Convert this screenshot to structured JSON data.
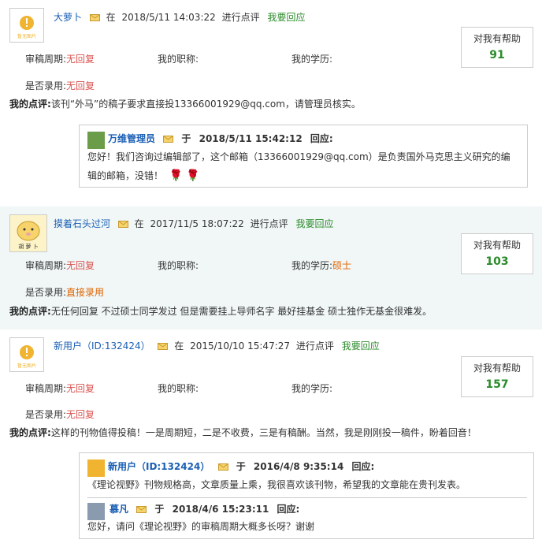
{
  "labels": {
    "period": "审稿周期:",
    "title": "我的职称:",
    "education": "我的学历:",
    "accepted": "是否录用:",
    "comment": "我的点评:",
    "help": "对我有帮助",
    "at": "在",
    "action": "进行点评",
    "respond": "我要回应",
    "in": "于",
    "reply": "回应:"
  },
  "avatar_caption": "暂无图片",
  "reviews": [
    {
      "user": "大萝卜",
      "time": "2018/5/11 14:03:22",
      "period": "无回复",
      "title": "",
      "education": "",
      "accepted": "无回复",
      "comment": "该刊“外马”的稿子要求直接投13366001929@qq.com，请管理员核实。",
      "help": "91",
      "reply": {
        "user": "万维管理员",
        "time": "2018/5/11 15:42:12",
        "text": "您好！我们咨询过编辑部了，这个邮箱（13366001929@qq.com）是负责国外马克思主义研究的编辑的邮箱，没错！"
      }
    },
    {
      "user": "摸着石头过河",
      "time": "2017/11/5 18:07:22",
      "period": "无回复",
      "title": "",
      "education": "硕士",
      "accepted": "直接录用",
      "comment": "无任何回复 不过硕士同学发过 但是需要挂上导师名字 最好挂基金 硕士独作无基金很难发。",
      "help": "103",
      "avatar_text": "胡 萝 卜"
    },
    {
      "user": "新用户（ID:132424）",
      "time": "2015/10/10 15:47:27",
      "period": "无回复",
      "title": "",
      "education": "",
      "accepted": "无回复",
      "comment": "这样的刊物值得投稿！一是周期短，二是不收费，三是有稿酬。当然，我是刚刚投一稿件，盼着回音！",
      "help": "157",
      "replies": [
        {
          "user": "新用户（ID:132424）",
          "time": "2016/4/8 9:35:14",
          "text": "《理论视野》刊物规格高，文章质量上乘，我很喜欢该刊物，希望我的文章能在贵刊发表。"
        },
        {
          "user": "慕凡",
          "time": "2018/4/6 15:23:11",
          "text": "您好，请问《理论视野》的审稿周期大概多长呀？谢谢"
        }
      ]
    }
  ]
}
